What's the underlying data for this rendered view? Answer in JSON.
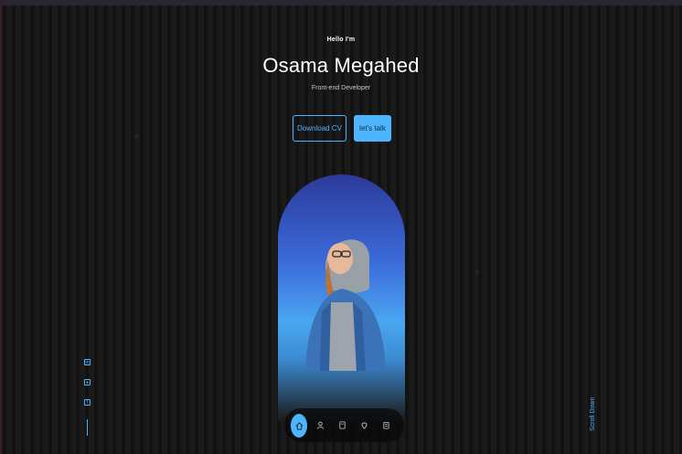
{
  "hero": {
    "greeting": "Hello I'm",
    "name": "Osama Megahed",
    "role": "Front-end Developer",
    "buttons": {
      "download": "Download CV",
      "talk": "let's talk"
    }
  },
  "social": {
    "icons": [
      "linkedin-icon",
      "github-icon",
      "facebook-icon"
    ]
  },
  "scroll_label": "Scroll Down",
  "bottom_nav": {
    "items": [
      "home-icon",
      "user-icon",
      "book-icon",
      "briefcase-icon",
      "message-icon"
    ],
    "active": "home-icon"
  },
  "colors": {
    "accent": "#4db5ff",
    "background": "#141414"
  }
}
